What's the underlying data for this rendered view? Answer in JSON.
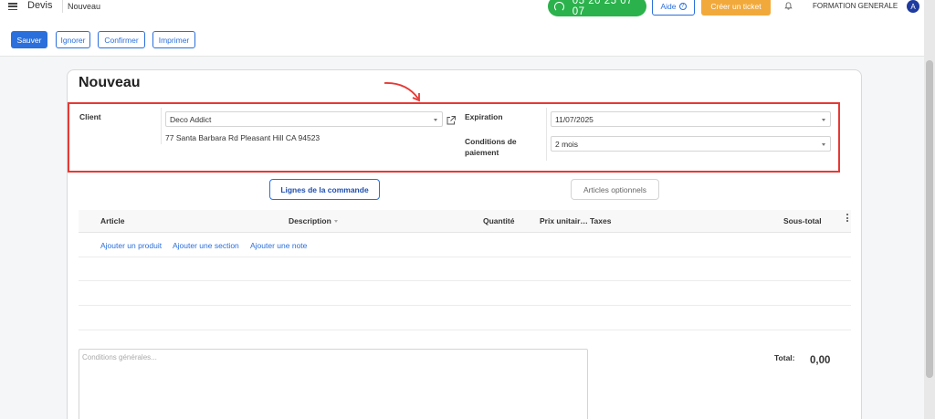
{
  "topbar": {
    "app_name": "Devis",
    "breadcrumb": "Nouveau",
    "phone": "05 20 25 07 07",
    "help_label": "Aide",
    "ticket_label": "Créer un ticket",
    "company": "FORMATION GENERALE",
    "avatar_initial": "A"
  },
  "toolbar": {
    "save_label": "Sauver",
    "discard_label": "Ignorer",
    "confirm_label": "Confirmer",
    "print_label": "Imprimer"
  },
  "form": {
    "title": "Nouveau",
    "client_label": "Client",
    "client_value": "Deco Addict",
    "client_address": "77 Santa Barbara Rd Pleasant Hill CA 94523",
    "expiration_label": "Expiration",
    "expiration_value": "11/07/2025",
    "payment_terms_label_1": "Conditions de",
    "payment_terms_label_2": "paiement",
    "payment_terms_value": "2 mois"
  },
  "tabs": {
    "order_lines": "Lignes de la commande",
    "optional_items": "Articles optionnels"
  },
  "table": {
    "columns": [
      "Article",
      "Description",
      "Quantité",
      "Prix unitair…",
      "Taxes",
      "Sous-total"
    ],
    "add_product": "Ajouter un produit",
    "add_section": "Ajouter une section",
    "add_note": "Ajouter une note"
  },
  "footer": {
    "terms_placeholder": "Conditions générales...",
    "total_label": "Total:",
    "total_value": "0,00"
  },
  "colors": {
    "primary": "#2a6fdb",
    "phone_green": "#2bb24c",
    "ticket_orange": "#f2a93b",
    "highlight_red": "#e53935"
  }
}
